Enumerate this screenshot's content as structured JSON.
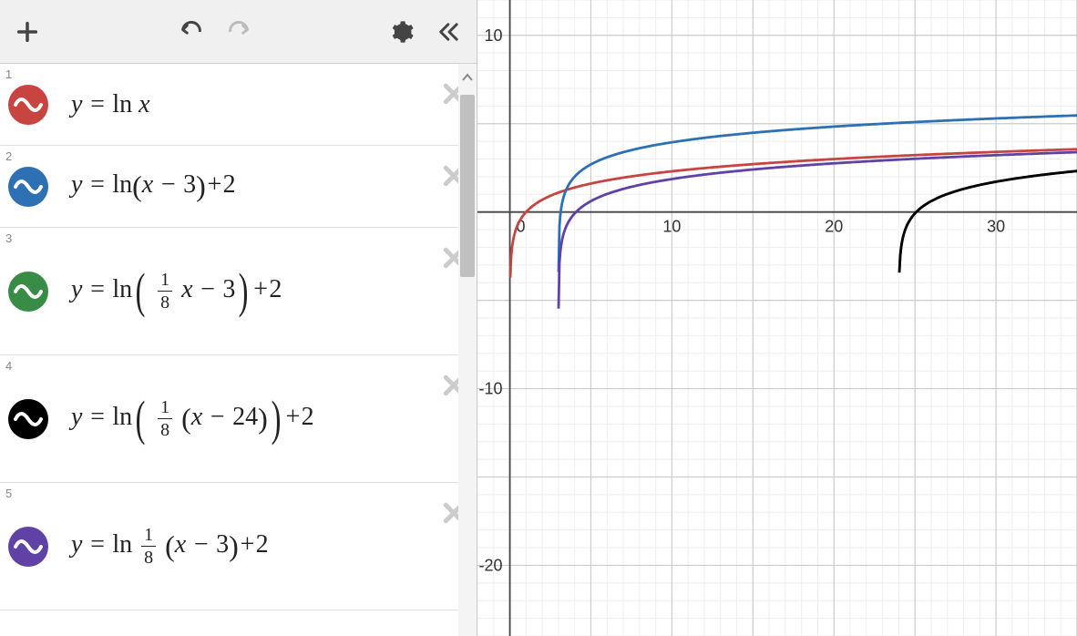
{
  "expressions": [
    {
      "index": "1",
      "formula_text": "y = ln x",
      "color": "#c74440"
    },
    {
      "index": "2",
      "formula_text": "y = ln(x − 3) + 2",
      "color": "#2d70b3"
    },
    {
      "index": "3",
      "formula_text": "y = ln(1/8 x − 3) + 2",
      "color": "#388c46"
    },
    {
      "index": "4",
      "formula_text": "y = ln(1/8 (x − 24)) + 2",
      "color": "#000000"
    },
    {
      "index": "5",
      "formula_text": "y = ln 1/8 (x − 3) + 2",
      "color": "#6042a6"
    }
  ],
  "chart_data": {
    "type": "line",
    "title": "",
    "xlabel": "",
    "ylabel": "",
    "xlim": [
      -2,
      35
    ],
    "ylim": [
      -24,
      12
    ],
    "x_ticks": [
      0,
      10,
      20,
      30
    ],
    "y_ticks": [
      -20,
      -10,
      10
    ],
    "series": [
      {
        "name": "y = ln x",
        "color": "#c74440",
        "expression": "ln(x)",
        "asymptote_x": 0
      },
      {
        "name": "y = ln(x-3)+2",
        "color": "#2d70b3",
        "expression": "ln(x-3)+2",
        "asymptote_x": 3
      },
      {
        "name": "y = ln((1/8)x - 3)+2",
        "color": "#388c46",
        "expression": "ln(x/8 - 3)+2",
        "asymptote_x": 24
      },
      {
        "name": "y = ln((1/8)(x-24))+2",
        "color": "#000000",
        "expression": "ln((x-24)/8)+2",
        "asymptote_x": 24
      },
      {
        "name": "y = ln(1/8) (x-3)+2",
        "color": "#6042a6",
        "expression": "ln(x-3)+2 + ln(1/8) ≈ ln(x-3)-0.079",
        "asymptote_x": 3
      }
    ]
  },
  "labels": {
    "origin": "0",
    "x10": "10",
    "x20": "20",
    "x30": "30",
    "y10": "10",
    "ym10": "-10",
    "ym20": "-20"
  }
}
